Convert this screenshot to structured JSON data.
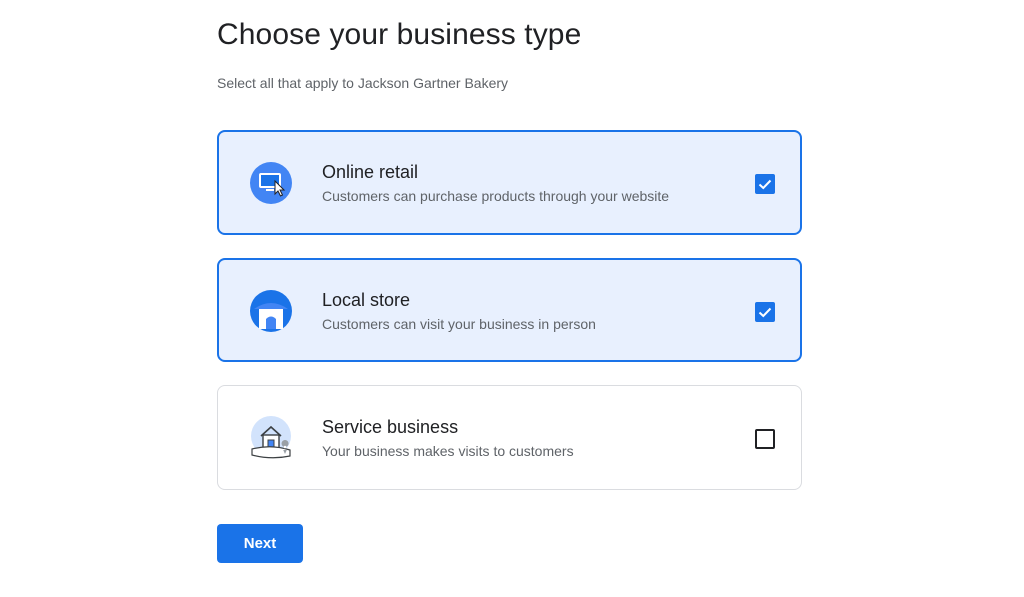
{
  "header": {
    "title": "Choose your business type",
    "subtitle": "Select all that apply to Jackson Gartner Bakery"
  },
  "options": [
    {
      "label": "Online retail",
      "description": "Customers can purchase products through your website",
      "icon": "online-retail-icon",
      "checked": true
    },
    {
      "label": "Local store",
      "description": "Customers can visit your business in person",
      "icon": "local-store-icon",
      "checked": true
    },
    {
      "label": "Service business",
      "description": "Your business makes visits to customers",
      "icon": "service-business-icon",
      "checked": false
    }
  ],
  "actions": {
    "next_label": "Next"
  },
  "colors": {
    "accent": "#1a73e8",
    "selected_bg": "#e8f0fe",
    "border": "#dadce0"
  }
}
